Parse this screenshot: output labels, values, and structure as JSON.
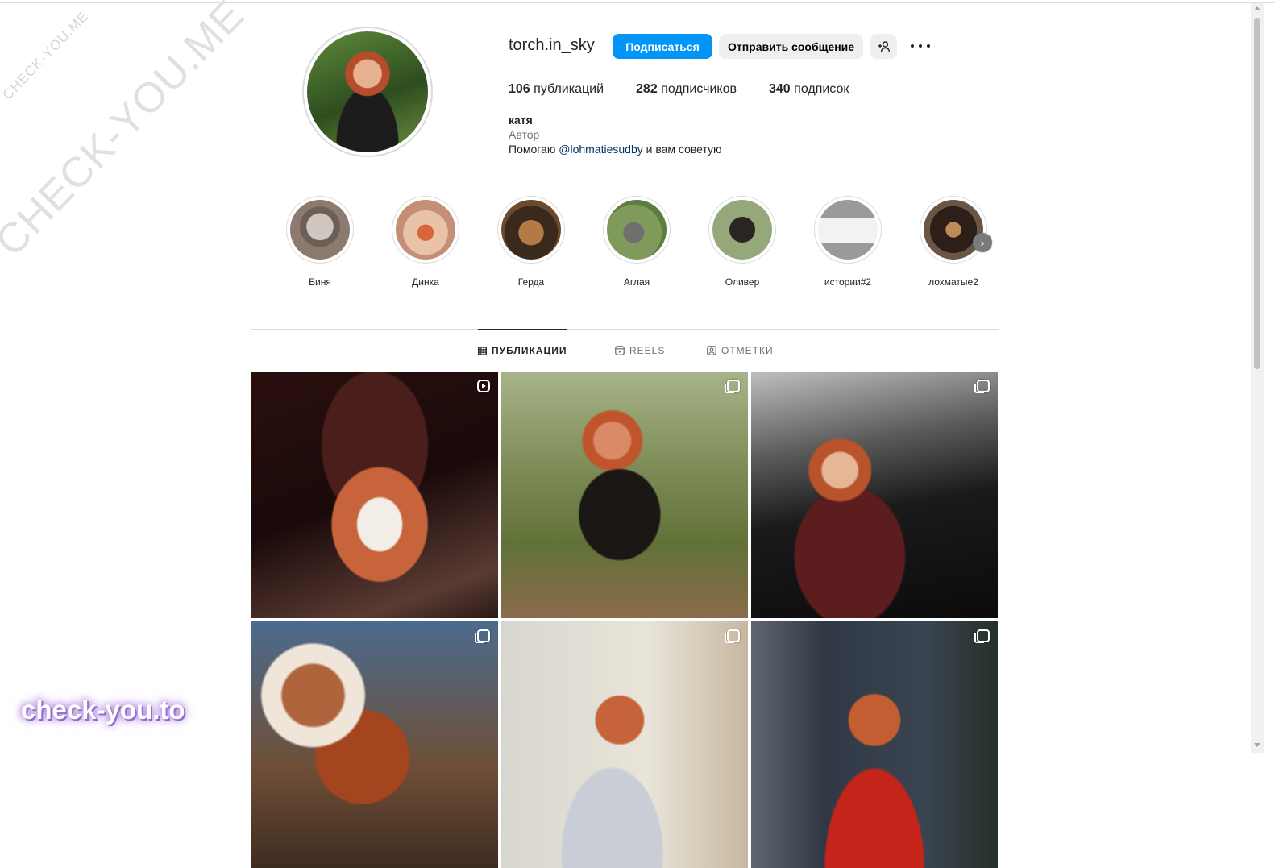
{
  "watermarks": {
    "small": "CHECK-YOU.ME",
    "big": "CHECK-YOU.ME",
    "bottom": "check-you.to"
  },
  "profile": {
    "username": "torch.in_sky",
    "follow_label": "Подписаться",
    "message_label": "Отправить сообщение",
    "stats": {
      "posts_count": "106",
      "posts_label": "публикаций",
      "followers_count": "282",
      "followers_label": "подписчиков",
      "following_count": "340",
      "following_label": "подписок"
    },
    "bio": {
      "name": "катя",
      "category": "Автор",
      "text_before": "Помогаю",
      "mention": "@lohmatiesudby",
      "text_after": "и вам советую"
    }
  },
  "highlights": [
    {
      "label": "Биня"
    },
    {
      "label": "Динка"
    },
    {
      "label": "Герда"
    },
    {
      "label": "Аглая"
    },
    {
      "label": "Оливер"
    },
    {
      "label": "истории#2"
    },
    {
      "label": "лохматые2"
    }
  ],
  "tabs": [
    {
      "label": "ПУБЛИКАЦИИ",
      "active": true
    },
    {
      "label": "REELS",
      "active": false
    },
    {
      "label": "ОТМЕТКИ",
      "active": false
    }
  ],
  "posts": [
    {
      "type": "reel"
    },
    {
      "type": "carousel"
    },
    {
      "type": "carousel"
    },
    {
      "type": "carousel"
    },
    {
      "type": "carousel"
    },
    {
      "type": "carousel"
    }
  ],
  "colors": {
    "primary_button": "#0095f6",
    "secondary_button": "#efefef",
    "link": "#00376b"
  }
}
